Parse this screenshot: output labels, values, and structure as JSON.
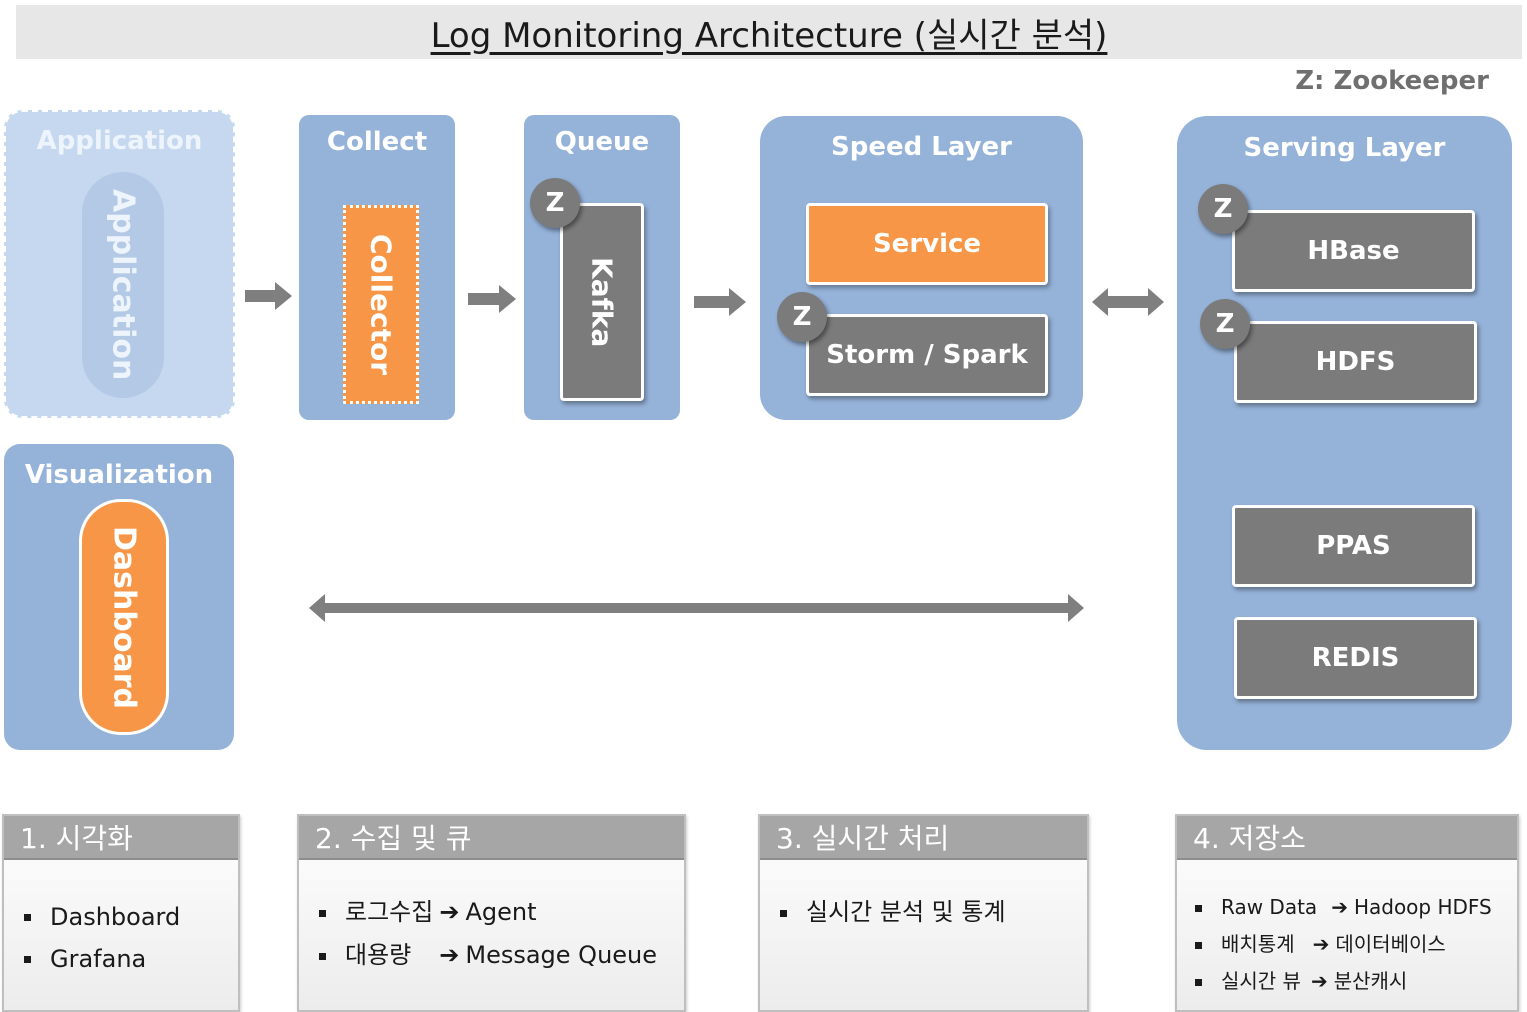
{
  "title": "Log Monitoring Architecture (실시간 분석)",
  "legend": "Z: Zookeeper",
  "badge_label": "Z",
  "colors": {
    "panel": "#95b2d8",
    "panel_faded": "#c5d8f0",
    "orange": "#f79646",
    "gray": "#7b7b7b",
    "arrow": "#7f7f7f"
  },
  "panels": {
    "application": {
      "title": "Application",
      "item": "Application"
    },
    "collect": {
      "title": "Collect",
      "item": "Collector"
    },
    "queue": {
      "title": "Queue",
      "item": "Kafka"
    },
    "speed": {
      "title": "Speed Layer",
      "items": [
        "Service",
        "Storm / Spark"
      ]
    },
    "serving": {
      "title": "Serving Layer",
      "items": [
        "HBase",
        "HDFS",
        "PPAS",
        "REDIS"
      ]
    },
    "visualization": {
      "title": "Visualization",
      "item": "Dashboard"
    }
  },
  "cards": [
    {
      "title": "1. 시각화",
      "items": [
        {
          "text": "Dashboard"
        },
        {
          "text": "Grafana"
        }
      ]
    },
    {
      "title": "2. 수집 및 큐",
      "items": [
        {
          "from": "로그수집",
          "arrow": "➔",
          "to": "Agent"
        },
        {
          "from": "대용량",
          "arrow": "➔",
          "to": "Message Queue"
        }
      ]
    },
    {
      "title": "3. 실시간 처리",
      "items": [
        {
          "text": "실시간 분석 및 통계"
        }
      ]
    },
    {
      "title": "4. 저장소",
      "items": [
        {
          "from": "Raw Data",
          "arrow": "➔",
          "to": "Hadoop HDFS"
        },
        {
          "from": "배치통계",
          "arrow": "➔",
          "to": "데이터베이스"
        },
        {
          "from": "실시간 뷰",
          "arrow": "➔",
          "to": "분산캐시"
        }
      ]
    }
  ]
}
